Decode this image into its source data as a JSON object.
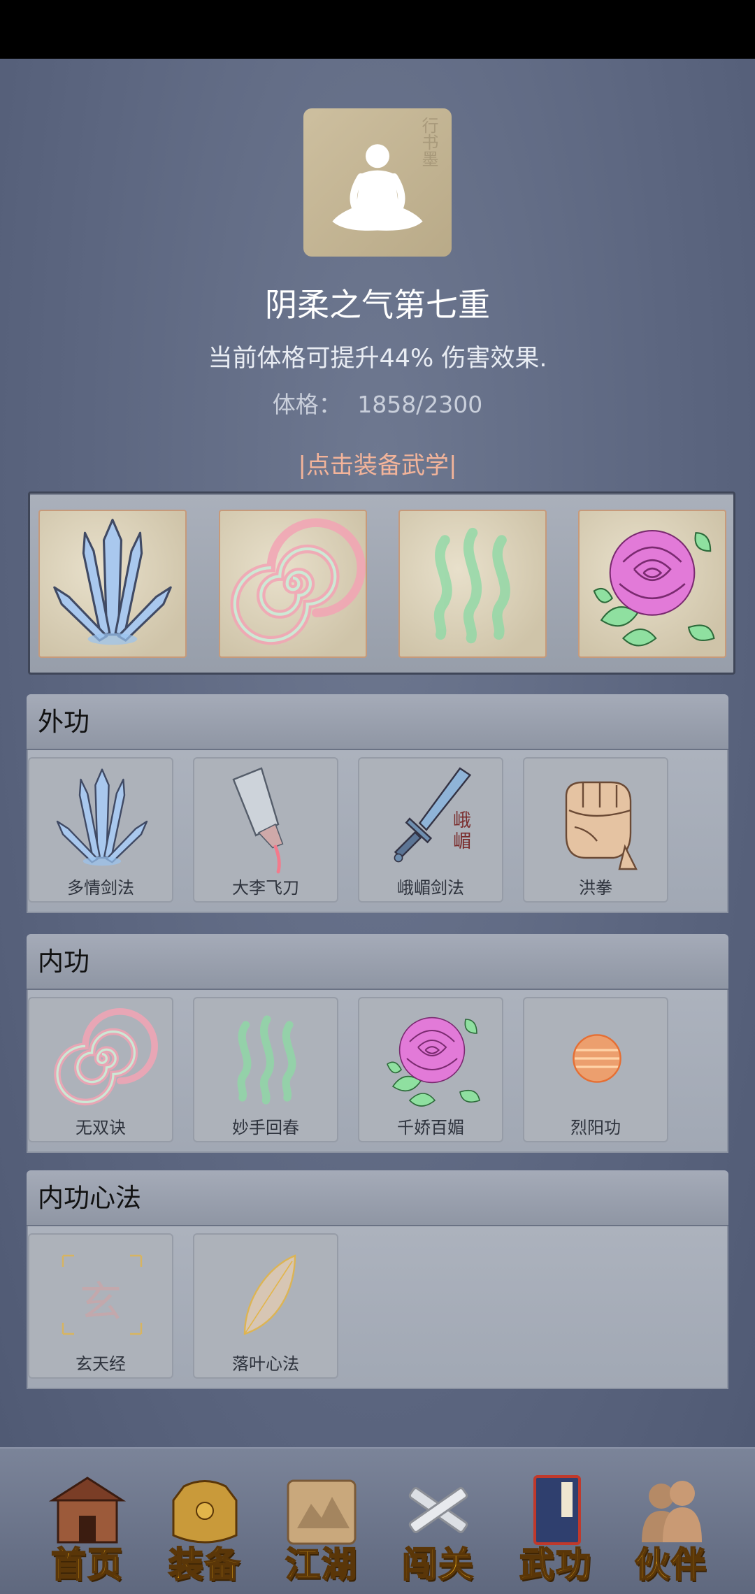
{
  "profile": {
    "realm": "阴柔之气第七重",
    "description": "当前体格可提升44% 伤害效果.",
    "stat_label": "体格：",
    "stat_value": "1858/2300",
    "equip_link": "|点击装备武学|"
  },
  "equipped": [
    {
      "icon": "sword-fan-icon"
    },
    {
      "icon": "spiral-icon"
    },
    {
      "icon": "green-wave-icon"
    },
    {
      "icon": "rose-icon"
    }
  ],
  "sections": {
    "outer": {
      "title": "外功",
      "skills": [
        {
          "label": "多情剑法",
          "icon": "sword-fan-icon"
        },
        {
          "label": "大李飞刀",
          "icon": "cleaver-icon"
        },
        {
          "label": "峨嵋剑法",
          "icon": "sword-icon",
          "icon_text": "峨\n嵋"
        },
        {
          "label": "洪拳",
          "icon": "fist-icon"
        }
      ]
    },
    "inner": {
      "title": "内功",
      "skills": [
        {
          "label": "无双诀",
          "icon": "spiral-icon"
        },
        {
          "label": "妙手回春",
          "icon": "green-wave-icon"
        },
        {
          "label": "千娇百媚",
          "icon": "rose-icon"
        },
        {
          "label": "烈阳功",
          "icon": "fire-orb-icon"
        }
      ]
    },
    "mind": {
      "title": "内功心法",
      "skills": [
        {
          "label": "玄天经",
          "icon": "xuan-seal-icon",
          "icon_text": "玄"
        },
        {
          "label": "落叶心法",
          "icon": "leaf-icon"
        }
      ]
    }
  },
  "nav": [
    {
      "label": "首页",
      "icon": "house-icon"
    },
    {
      "label": "装备",
      "icon": "armor-icon"
    },
    {
      "label": "江湖",
      "icon": "scroll-map-icon"
    },
    {
      "label": "闯关",
      "icon": "crossed-swords-icon"
    },
    {
      "label": "武功",
      "icon": "book-icon"
    },
    {
      "label": "伙伴",
      "icon": "partners-icon"
    }
  ],
  "colors": {
    "background": "#5f6a82",
    "link": "#f3b49a",
    "nav_text": "#f1b21d"
  }
}
